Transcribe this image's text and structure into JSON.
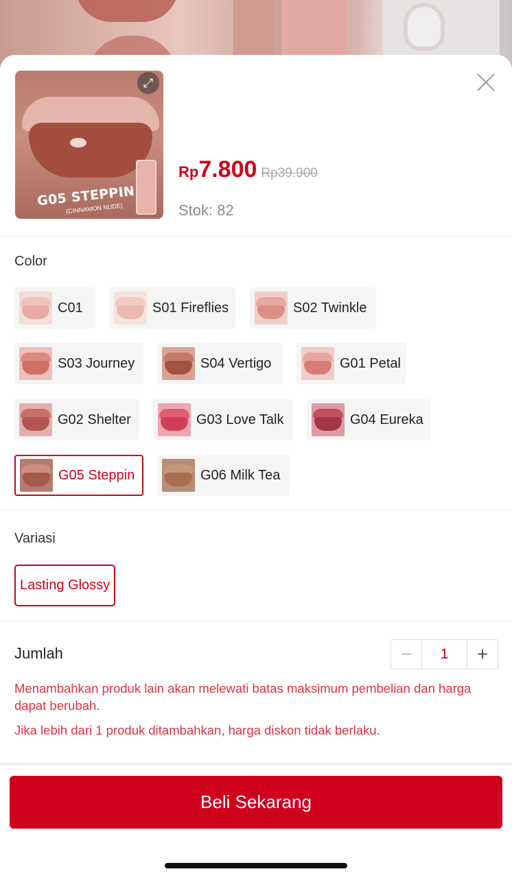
{
  "product": {
    "image_label": "G05 STEPPIN",
    "image_sublabel": "(CINNAMON NUDE)",
    "price_currency": "Rp",
    "price": "7.800",
    "original_price": "Rp39.900",
    "stock": "Stok: 82"
  },
  "color": {
    "label": "Color",
    "options": [
      {
        "label": "C01",
        "swatch_top": "#efc3bd",
        "swatch_bot": "#e8aaa4",
        "bg": "#f4dcd8",
        "selected": false
      },
      {
        "label": "S01 Fireflies",
        "swatch_top": "#f2cbc3",
        "swatch_bot": "#ecb9af",
        "bg": "#f6e2dd",
        "selected": false
      },
      {
        "label": "S02 Twinkle",
        "swatch_top": "#e6a79e",
        "swatch_bot": "#dc8f86",
        "bg": "#f1cfc9",
        "selected": false
      },
      {
        "label": "S03 Journey",
        "swatch_top": "#dd8a80",
        "swatch_bot": "#cf7064",
        "bg": "#ecc0b8",
        "selected": false
      },
      {
        "label": "S04 Vertigo",
        "swatch_top": "#c47a68",
        "swatch_bot": "#a3533f",
        "bg": "#d9a294",
        "selected": false
      },
      {
        "label": "G01 Petal",
        "swatch_top": "#e7a8a2",
        "swatch_bot": "#d57c77",
        "bg": "#f1cbc7",
        "selected": false
      },
      {
        "label": "G02 Shelter",
        "swatch_top": "#c86f6a",
        "swatch_bot": "#b25652",
        "bg": "#e3b1ad",
        "selected": false
      },
      {
        "label": "G03 Love Talk",
        "swatch_top": "#e05d72",
        "swatch_bot": "#d23e58",
        "bg": "#eea6b1",
        "selected": false
      },
      {
        "label": "G04 Eureka",
        "swatch_top": "#c24e5f",
        "swatch_bot": "#a63647",
        "bg": "#dd9aa3",
        "selected": false
      },
      {
        "label": "G05 Steppin",
        "swatch_top": "#c98e80",
        "swatch_bot": "#a55b49",
        "bg": "#b47b6f",
        "selected": true
      },
      {
        "label": "G06 Milk Tea",
        "swatch_top": "#c79679",
        "swatch_bot": "#a86f4e",
        "bg": "#b88d75",
        "selected": false
      }
    ]
  },
  "variation": {
    "label": "Variasi",
    "option": "Lasting Glossy"
  },
  "quantity": {
    "label": "Jumlah",
    "value": "1",
    "minus": "−",
    "plus": "+"
  },
  "warnings": {
    "line1": "Menambahkan produk lain akan melewati batas maksimum pembelian dan harga dapat berubah.",
    "line2": "Jika lebih dari 1 produk ditambahkan, harga diskon tidak berlaku."
  },
  "cta": {
    "label": "Beli Sekarang"
  },
  "colors": {
    "accent": "#d0011b",
    "warning": "#e0313f"
  }
}
